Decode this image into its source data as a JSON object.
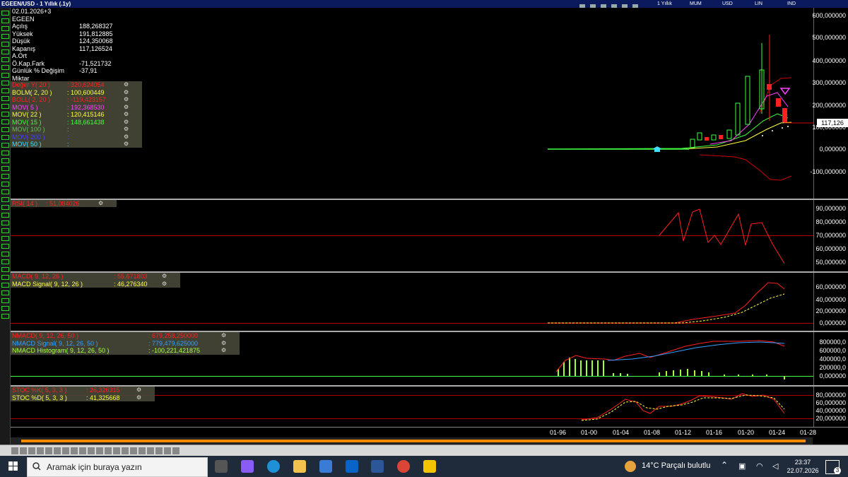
{
  "window": {
    "title": "EGEEN/USD - 1 Yıllık (.1y)",
    "options": [
      "1 Yıllık",
      "MUM",
      "USD",
      "LIN",
      "IND"
    ]
  },
  "ohlc_panel": {
    "date": "02.01.2026+3",
    "symbol": "EGEEN",
    "rows": [
      {
        "label": "Açılış",
        "value": "188,268327"
      },
      {
        "label": "Yüksek",
        "value": "191,812885"
      },
      {
        "label": "Düşük",
        "value": "124,350068"
      },
      {
        "label": "Kapanış",
        "value": "117,126524"
      },
      {
        "label": "A.Ort",
        "value": ""
      },
      {
        "label": "Ö.Kap.Fark",
        "value": "-71,521732"
      },
      {
        "label": "Günlük % Değişim",
        "value": "-37,91"
      },
      {
        "label": "Miktar",
        "value": ""
      }
    ]
  },
  "price_indicators": [
    {
      "name": "Değer Y( 20 )",
      "value": ": 320,624054",
      "color": "#ff2020"
    },
    {
      "name": "BOLM( 2, 20 )",
      "value": ": 100,600449",
      "color": "#ffff40"
    },
    {
      "name": "BOLL( 2, 20 )",
      "value": ": -119,423157",
      "color": "#ff2020"
    },
    {
      "name": "MOV( 5 )",
      "value": ": 192,368530",
      "color": "#ff40ff"
    },
    {
      "name": "MOV( 22 )",
      "value": ": 120,415146",
      "color": "#ffff40"
    },
    {
      "name": "MOV( 15 )",
      "value": ": 148,661438",
      "color": "#40ff40"
    },
    {
      "name": "MOV( 100 )",
      "value": ":",
      "color": "#60c060"
    },
    {
      "name": "MOV( 200 )",
      "value": ":",
      "color": "#4040ff"
    },
    {
      "name": "MOV( 50 )",
      "value": ":",
      "color": "#40e0ff"
    }
  ],
  "price_axis": [
    "600,000000",
    "500,000000",
    "400,000000",
    "300,000000",
    "200,000000",
    "100,000000",
    "0,000000",
    "-100,000000"
  ],
  "last_price": "117,126",
  "rsi": {
    "label": "RSI( 14 )",
    "value": ": 51,084026",
    "axis": [
      "90,000000",
      "80,000000",
      "70,000000",
      "60,000000",
      "50,000000"
    ]
  },
  "macd": {
    "rows": [
      {
        "name": "MACD( 9, 12, 26 )",
        "value": ": 55,671803",
        "color": "#ff2020"
      },
      {
        "name": "MACD Signal( 9, 12, 26 )",
        "value": ": 46,276340",
        "color": "#ffff40"
      }
    ],
    "axis": [
      "60,000000",
      "40,000000",
      "20,000000",
      "0,000000"
    ]
  },
  "nmacd": {
    "rows": [
      {
        "name": "NMACD( 9, 12, 26, 50 )",
        "value": ": 679,258,250000",
        "color": "#ff2020"
      },
      {
        "name": "NMACD Signal( 9, 12, 26, 50 )",
        "value": ": 779,479,625000",
        "color": "#30a0ff"
      },
      {
        "name": "NMACD Histogram( 9, 12, 26, 50 )",
        "value": ": -100,221,421875",
        "color": "#a0ff40"
      }
    ],
    "axis": [
      "800000,0",
      "600000,0",
      "400000,0",
      "200000,0",
      "0,000000"
    ]
  },
  "stoc": {
    "rows": [
      {
        "name": "STOC %K( 5, 3, 3 )",
        "value": ": 26,326315",
        "color": "#ff2020"
      },
      {
        "name": "STOC %D( 5, 3, 3 )",
        "value": ": 41,325668",
        "color": "#ffff40"
      }
    ],
    "axis": [
      "80,000000",
      "60,000000",
      "40,000000",
      "20,000000"
    ]
  },
  "time_axis": [
    "01-96",
    "01-00",
    "01-04",
    "01-08",
    "01-12",
    "01-16",
    "01-20",
    "01-24",
    "01-28"
  ],
  "taskbar": {
    "search_placeholder": "Aramak için buraya yazın",
    "weather": "14°C  Parçalı bulutlu",
    "time": "23:37",
    "date": "22.07.2026",
    "notifications": "3"
  }
}
